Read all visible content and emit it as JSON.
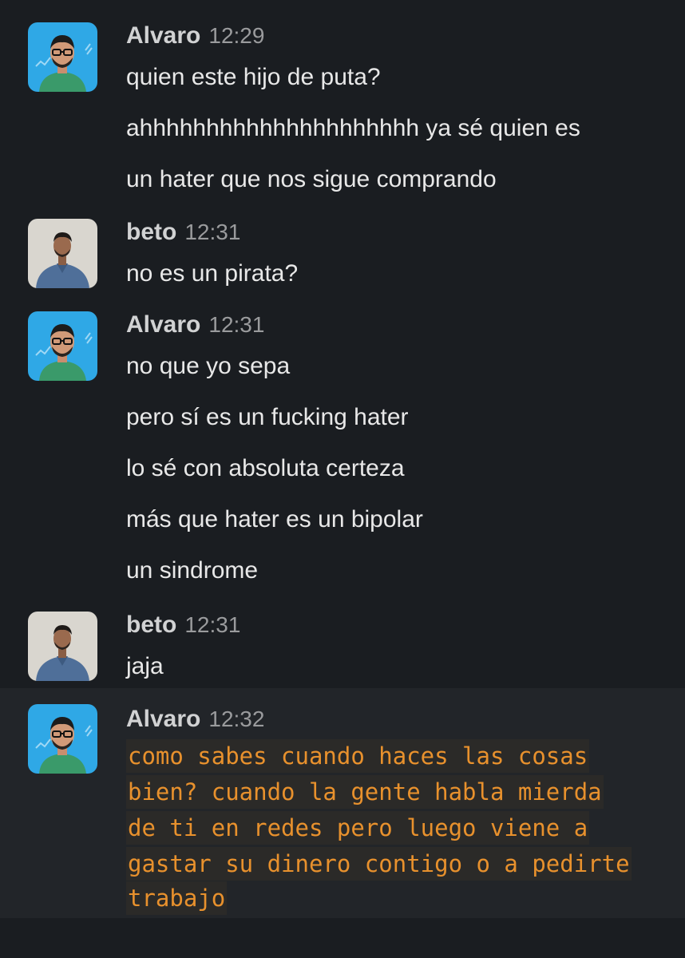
{
  "messages": [
    {
      "author": "Alvaro",
      "time": "12:29",
      "avatar": "alvaro-avatar",
      "lines": [
        "quien este hijo de puta?",
        "ahhhhhhhhhhhhhhhhhhhhh ya sé quien es",
        "un hater que nos sigue comprando"
      ]
    },
    {
      "author": "beto",
      "time": "12:31",
      "avatar": "beto-avatar",
      "lines": [
        "no es un pirata?"
      ]
    },
    {
      "author": "Alvaro",
      "time": "12:31",
      "avatar": "alvaro-avatar",
      "lines": [
        "no que yo sepa",
        "pero sí es un fucking hater",
        "lo sé con absoluta certeza",
        "más que hater es un bipolar",
        "un sindrome"
      ]
    },
    {
      "author": "beto",
      "time": "12:31",
      "avatar": "beto-avatar",
      "lines": [
        "jaja"
      ]
    },
    {
      "author": "Alvaro",
      "time": "12:32",
      "avatar": "alvaro-avatar",
      "highlighted": true,
      "code_lines": [
        "como sabes cuando haces las cosas",
        "bien? cuando la gente habla mierda",
        "de ti en redes pero luego viene a",
        "gastar su dinero contigo o a pedirte",
        "trabajo"
      ]
    }
  ],
  "colors": {
    "background": "#1a1d21",
    "highlight_background": "#222529",
    "code_text": "#e8912d",
    "timestamp": "#9a9b9d"
  }
}
